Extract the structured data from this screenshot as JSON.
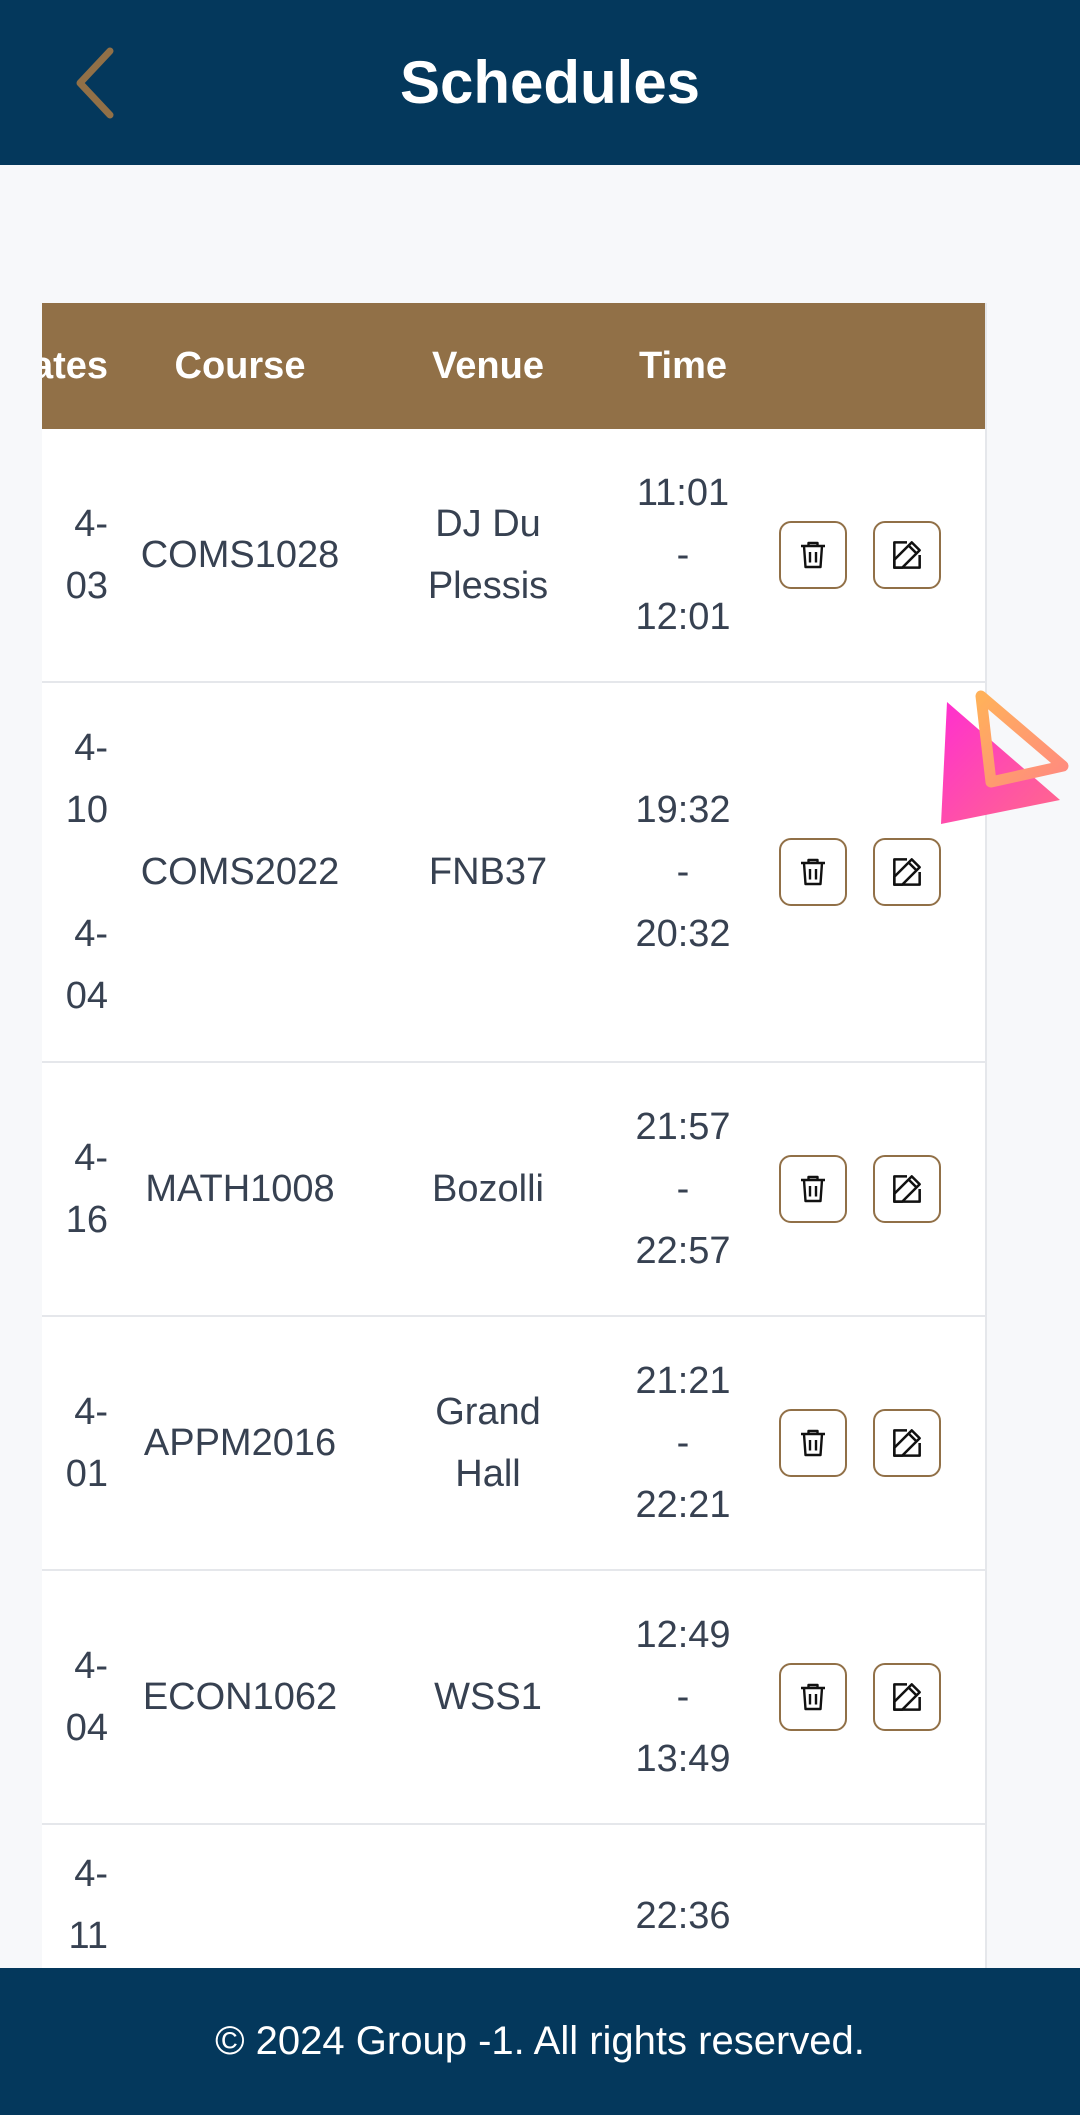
{
  "header": {
    "title": "Schedules",
    "back_icon": "chevron-left-icon"
  },
  "table": {
    "columns": [
      "Dates",
      "Course",
      "Venue",
      "Time",
      ""
    ],
    "rows": [
      {
        "dates": [
          "4-",
          "03"
        ],
        "course": "COMS1028",
        "venue": [
          "DJ Du",
          "Plessis"
        ],
        "time": [
          "11:01",
          "-",
          "12:01"
        ]
      },
      {
        "dates": [
          "4-",
          "10",
          "",
          "4-",
          "04"
        ],
        "course": "COMS2022",
        "venue": [
          "FNB37"
        ],
        "time": [
          "19:32",
          "-",
          "20:32"
        ]
      },
      {
        "dates": [
          "4-",
          "16"
        ],
        "course": "MATH1008",
        "venue": [
          "Bozolli"
        ],
        "time": [
          "21:57",
          "-",
          "22:57"
        ]
      },
      {
        "dates": [
          "4-",
          "01"
        ],
        "course": "APPM2016",
        "venue": [
          "Grand",
          "Hall"
        ],
        "time": [
          "21:21",
          "-",
          "22:21"
        ]
      },
      {
        "dates": [
          "4-",
          "04"
        ],
        "course": "ECON1062",
        "venue": [
          "WSS1"
        ],
        "time": [
          "12:49",
          "-",
          "13:49"
        ]
      },
      {
        "dates": [
          "4-",
          "11"
        ],
        "course": "",
        "venue": [
          ""
        ],
        "time": [
          "22:36"
        ]
      }
    ],
    "delete_icon": "trash-icon",
    "edit_icon": "edit-icon"
  },
  "footer": {
    "text": "© 2024 Group -1. All rights reserved."
  },
  "colors": {
    "navy": "#04385c",
    "brown": "#917047",
    "accent_pink": "#ff3dbb",
    "accent_orange": "#ffa26b"
  }
}
